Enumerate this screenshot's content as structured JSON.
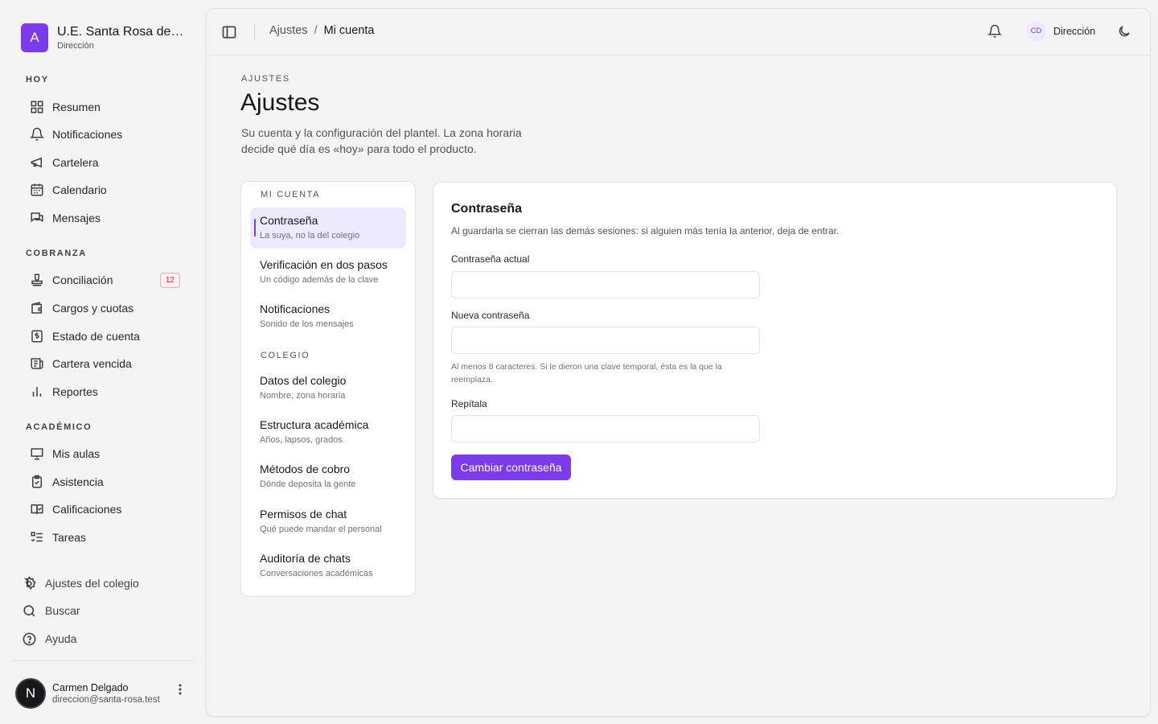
{
  "brand": {
    "logo_letter": "A",
    "name": "U.E. Santa Rosa de Lima",
    "role": "Dirección"
  },
  "sidebar": {
    "sections": [
      {
        "label": "HOY"
      },
      {
        "label": "COBRANZA"
      },
      {
        "label": "ACADÉMICO"
      }
    ],
    "items": [
      {
        "label": "Resumen",
        "icon": "grid-icon"
      },
      {
        "label": "Notificaciones",
        "icon": "bell-icon"
      },
      {
        "label": "Cartelera",
        "icon": "megaphone-icon"
      },
      {
        "label": "Calendario",
        "icon": "calendar-icon"
      },
      {
        "label": "Mensajes",
        "icon": "chat-icon"
      },
      {
        "label": "Conciliación",
        "icon": "stamp-icon",
        "badge": "12"
      },
      {
        "label": "Cargos y cuotas",
        "icon": "wallet-icon"
      },
      {
        "label": "Estado de cuenta",
        "icon": "statement-icon"
      },
      {
        "label": "Cartera vencida",
        "icon": "receipt-icon"
      },
      {
        "label": "Reportes",
        "icon": "bar-chart-icon"
      },
      {
        "label": "Mis aulas",
        "icon": "presentation-icon"
      },
      {
        "label": "Asistencia",
        "icon": "clipboard-check-icon"
      },
      {
        "label": "Calificaciones",
        "icon": "book-check-icon"
      },
      {
        "label": "Tareas",
        "icon": "list-todo-icon"
      }
    ],
    "bottom": [
      {
        "label": "Ajustes del colegio",
        "icon": "gear-icon"
      },
      {
        "label": "Buscar",
        "icon": "search-icon"
      },
      {
        "label": "Ayuda",
        "icon": "help-icon"
      }
    ],
    "user": {
      "avatar_letter": "N",
      "name": "Carmen Delgado",
      "email": "direccion@santa-rosa.test"
    }
  },
  "topbar": {
    "breadcrumb": {
      "parent": "Ajustes",
      "separator": "/",
      "current": "Mi cuenta"
    },
    "account": {
      "initials": "CD",
      "label": "Dirección"
    }
  },
  "page": {
    "eyebrow": "AJUSTES",
    "title": "Ajustes",
    "description": "Su cuenta y la configuración del plantel. La zona horaria decide qué día es «hoy» para todo el producto."
  },
  "settings_nav": {
    "sections": [
      "MI CUENTA",
      "COLEGIO"
    ],
    "items": [
      {
        "title": "Contraseña",
        "subtitle": "La suya, no la del colegio",
        "active": true
      },
      {
        "title": "Verificación en dos pasos",
        "subtitle": "Un código además de la clave"
      },
      {
        "title": "Notificaciones",
        "subtitle": "Sonido de los mensajes"
      },
      {
        "title": "Datos del colegio",
        "subtitle": "Nombre, zona horaria"
      },
      {
        "title": "Estructura académica",
        "subtitle": "Años, lapsos, grados"
      },
      {
        "title": "Métodos de cobro",
        "subtitle": "Dónde deposita la gente"
      },
      {
        "title": "Permisos de chat",
        "subtitle": "Qué puede mandar el personal"
      },
      {
        "title": "Auditoría de chats",
        "subtitle": "Conversaciones académicas"
      }
    ]
  },
  "password_form": {
    "title": "Contraseña",
    "description": "Al guardarla se cierran las demás sesiones: si alguien más tenía la anterior, deja de entrar.",
    "current_label": "Contraseña actual",
    "current_value": "",
    "new_label": "Nueva contraseña",
    "new_value": "",
    "new_hint": "Al menos 8 caracteres. Si le dieron una clave temporal, ésta es la que la reemplaza.",
    "repeat_label": "Repítala",
    "repeat_value": "",
    "submit_label": "Cambiar contraseña"
  },
  "colors": {
    "accent": "#7c3aed",
    "accent_soft": "#ede9fe",
    "badge_red": "#dc2626",
    "background": "#f4f4f5"
  }
}
